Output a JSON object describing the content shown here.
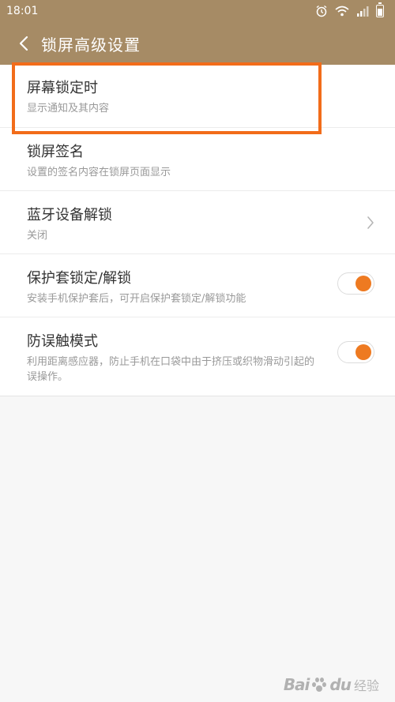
{
  "status_bar": {
    "time": "18:01",
    "icons": [
      "alarm-icon",
      "wifi-icon",
      "signal-icon",
      "battery-icon"
    ]
  },
  "header": {
    "back_icon": "chevron-left-icon",
    "title": "锁屏高级设置"
  },
  "settings": [
    {
      "title": "屏幕锁定时",
      "subtitle": "显示通知及其内容",
      "control": "none",
      "highlighted": true
    },
    {
      "title": "锁屏签名",
      "subtitle": "设置的签名内容在锁屏页面显示",
      "control": "none"
    },
    {
      "title": "蓝牙设备解锁",
      "subtitle": "关闭",
      "control": "chevron-right-icon"
    },
    {
      "title": "保护套锁定/解锁",
      "subtitle": "安装手机保护套后，可开启保护套锁定/解锁功能",
      "control": "toggle",
      "enabled": true
    },
    {
      "title": "防误触模式",
      "subtitle": "利用距离感应器，防止手机在口袋中由于挤压或织物滑动引起的误操作。",
      "control": "toggle",
      "enabled": true
    }
  ],
  "watermark": {
    "text": "Bai",
    "text2": "du",
    "label": "经验"
  },
  "colors": {
    "header_bg": "#a68b65",
    "toggle_accent": "#ee7a21",
    "highlight_border": "#f26c1a"
  }
}
